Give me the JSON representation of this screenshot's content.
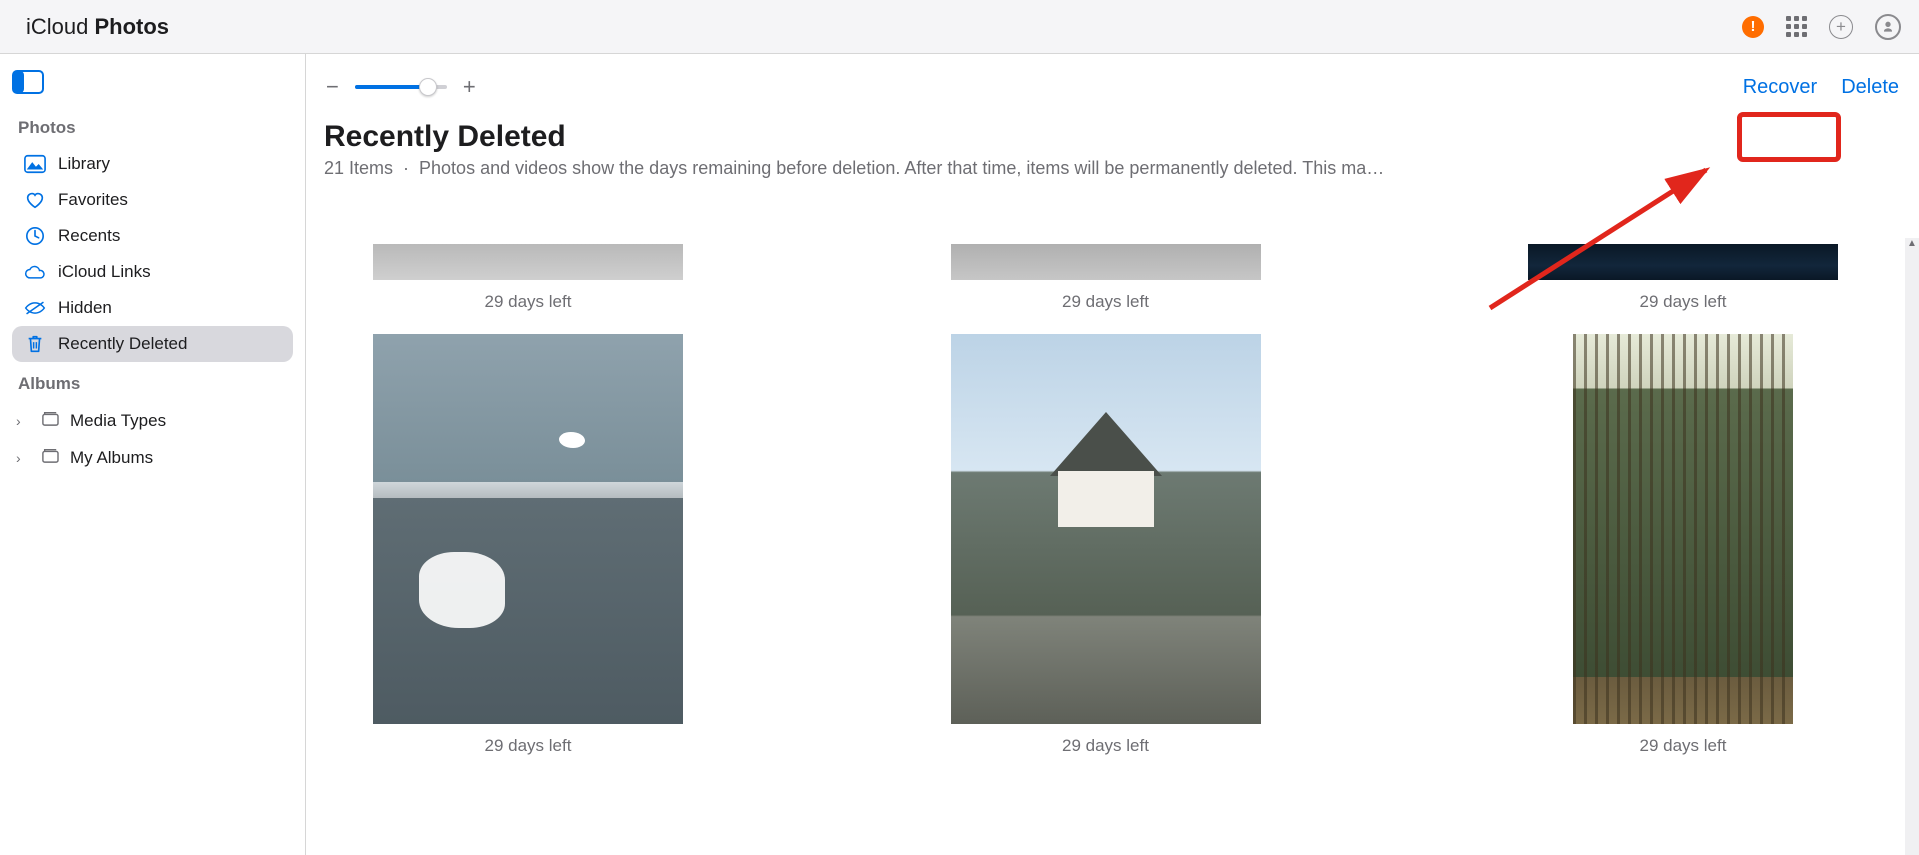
{
  "header": {
    "brand_prefix": "iCloud ",
    "brand_bold": "Photos"
  },
  "sidebar": {
    "photos_label": "Photos",
    "albums_label": "Albums",
    "items": [
      {
        "label": "Library"
      },
      {
        "label": "Favorites"
      },
      {
        "label": "Recents"
      },
      {
        "label": "iCloud Links"
      },
      {
        "label": "Hidden"
      },
      {
        "label": "Recently Deleted"
      }
    ],
    "albums": [
      {
        "label": "Media Types"
      },
      {
        "label": "My Albums"
      }
    ]
  },
  "toolbar": {
    "recover_label": "Recover",
    "delete_label": "Delete"
  },
  "page": {
    "title": "Recently Deleted",
    "item_count_text": "21 Items",
    "subtitle_tail": "Photos and videos show the days remaining before deletion. After that time, items will be permanently deleted. This ma…"
  },
  "thumbnails": {
    "row1": [
      {
        "days_left": "29 days left"
      },
      {
        "days_left": "29 days left"
      },
      {
        "days_left": "29 days left"
      }
    ],
    "row2": [
      {
        "days_left": "29 days left"
      },
      {
        "days_left": "29 days left"
      },
      {
        "days_left": "29 days left"
      }
    ]
  }
}
